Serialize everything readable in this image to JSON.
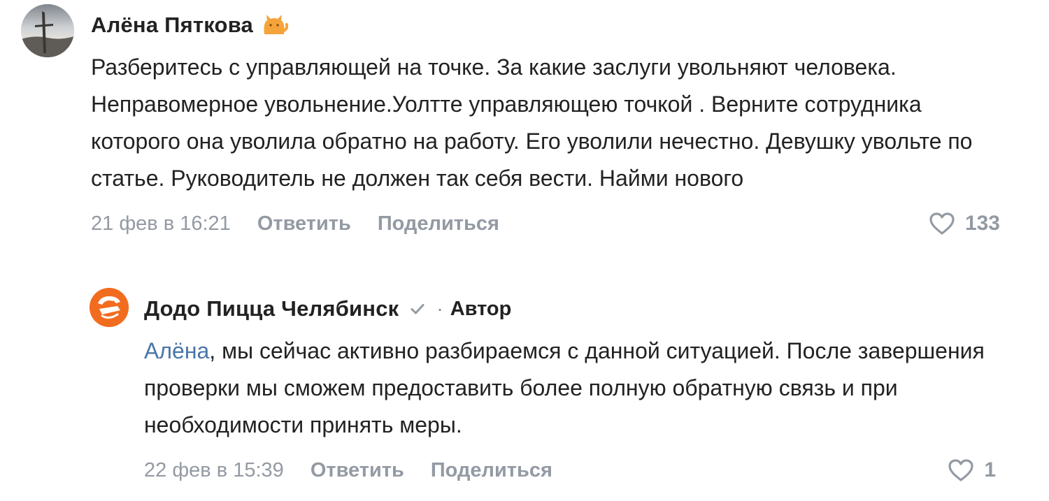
{
  "comments": [
    {
      "author": "Алёна Пяткова",
      "author_icon": "cat-emoji-icon",
      "text": "Разберитесь с управляющей на точке. За какие заслуги увольняют человека. Неправомерное увольнение.Уолтте управляющею точкой . Верните сотрудника которого она уволила обратно на работу. Его уволили нечестно. Девушку увольте по статье. Руководитель не должен так себя вести. Найми нового",
      "date": "21 фев в 16:21",
      "reply_label": "Ответить",
      "share_label": "Поделиться",
      "likes": "133"
    }
  ],
  "reply": {
    "author": "Додо Пицца Челябинск",
    "verified_icon": "verified-check-icon",
    "separator": "·",
    "role": "Автор",
    "mention": "Алёна",
    "text": ", мы сейчас активно разбираемся с данной ситуацией. После завершения проверки мы сможем предоставить более полную обратную связь и при необходимости принять меры.",
    "date": "22 фев в 15:39",
    "reply_label": "Ответить",
    "share_label": "Поделиться",
    "likes": "1"
  },
  "colors": {
    "text": "#222222",
    "secondary": "#939aa3",
    "mention": "#4a76a8",
    "brand_orange": "#f26c1f"
  }
}
